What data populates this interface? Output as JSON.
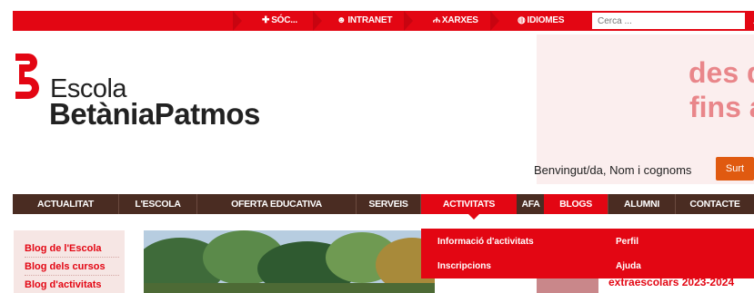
{
  "topbar": {
    "items": [
      {
        "label": "SÓC...",
        "icon": "plus-icon"
      },
      {
        "label": "INTRANET",
        "icon": "smiley-icon"
      },
      {
        "label": "XARXES",
        "icon": "sitemap-icon"
      },
      {
        "label": "IDIOMES",
        "icon": "globe-icon"
      }
    ],
    "search_placeholder": "Cerca ..."
  },
  "logo": {
    "line1": "Escola",
    "line2": "BetàniaPatmos"
  },
  "hero": {
    "line1": "des d",
    "line2": "fins a"
  },
  "user": {
    "welcome": "Benvingut/da, Nom i cognoms",
    "logout_label": "Surt"
  },
  "nav": {
    "items": [
      "ACTUALITAT",
      "L'ESCOLA",
      "OFERTA EDUCATIVA",
      "SERVEIS",
      "ACTIVITATS",
      "AFA",
      "BLOGS",
      "ALUMNI",
      "CONTACTE"
    ],
    "active": "ACTIVITATS"
  },
  "sidebar": {
    "items": [
      "Blog de l'Escola",
      "Blog dels cursos",
      "Blog d'activitats"
    ]
  },
  "dropdown": {
    "col1": [
      "Informació d'activitats",
      "Inscripcions"
    ],
    "col2": [
      "Perfil",
      "Ajuda"
    ]
  },
  "promo": {
    "text": "extraescolars 2023-2024"
  },
  "colors": {
    "brand_red": "#e30613",
    "nav_brown": "#4a2c22"
  }
}
